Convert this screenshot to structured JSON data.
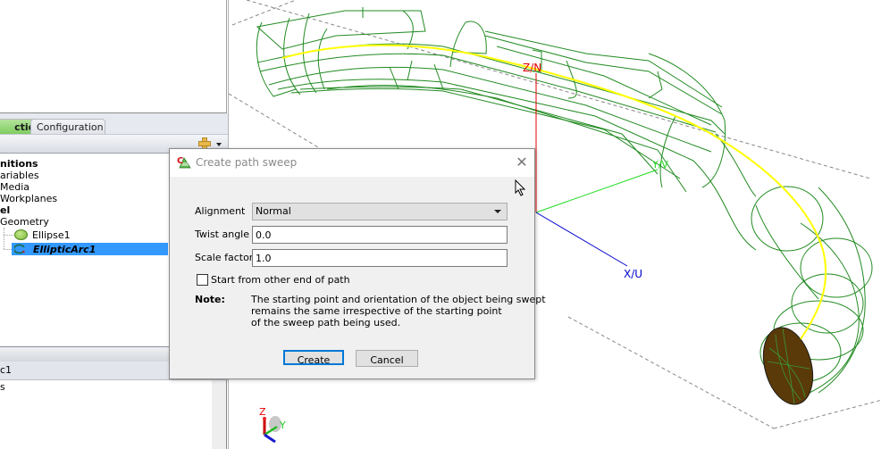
{
  "left_panel": {
    "tabs": [
      {
        "label": "ction",
        "active": true
      },
      {
        "label": "Configuration",
        "active": false
      }
    ],
    "tree": [
      {
        "label": "nitions",
        "bold": true
      },
      {
        "label": "ariables",
        "bold": false
      },
      {
        "label": "Media",
        "bold": false
      },
      {
        "label": "Workplanes",
        "bold": false
      },
      {
        "label": "el",
        "bold": true
      },
      {
        "label": "Geometry",
        "bold": false
      },
      {
        "label": "Ellipse1",
        "bold": false,
        "icon": "ellipse-icon"
      },
      {
        "label": "EllipticArc1",
        "bold": true,
        "italic": true,
        "icon": "elliptic-arc-icon",
        "selected": true
      }
    ],
    "properties": {
      "header": "c1",
      "row1": "s"
    }
  },
  "viewport": {
    "axis_labels": {
      "z": "Z/N",
      "y": "Y/V",
      "x": "X/U"
    },
    "triad_labels": {
      "z": "Z",
      "y": "Y"
    },
    "colors": {
      "wireframe": "#228b22",
      "path": "#ffff00",
      "z_axis": "#e00000",
      "y_axis": "#22dd22",
      "x_axis": "#0000cc",
      "face_fill": "#5a3a08"
    }
  },
  "dialog": {
    "title": "Create path sweep",
    "alignment_label": "Alignment",
    "alignment_value": "Normal",
    "twist_label": "Twist angle",
    "twist_value": "0.0",
    "scale_label": "Scale factor",
    "scale_value": "1.0",
    "checkbox_label": "Start from other end of path",
    "checkbox_checked": false,
    "note_label": "Note:",
    "note_text": "The starting point and orientation of the object being swept\nremains the same irrespective of the starting point\nof the sweep path being used.",
    "create_label": "Create",
    "cancel_label": "Cancel",
    "close_glyph": "✕"
  }
}
